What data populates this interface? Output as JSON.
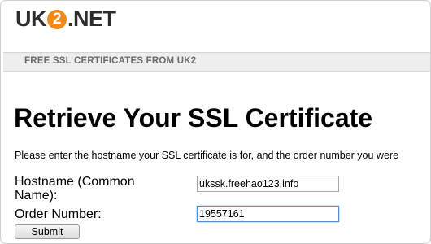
{
  "header": {
    "logo": {
      "prefix": "UK",
      "badge": "2",
      "suffix": ".NET"
    }
  },
  "banner": {
    "text": "FREE SSL CERTIFICATES FROM UK2"
  },
  "main": {
    "title": "Retrieve Your SSL Certificate",
    "instructions": "Please enter the hostname your SSL certificate is for, and the order number you were",
    "form": {
      "hostname_label": "Hostname (Common Name):",
      "hostname_value": "ukssk.freehao123.info",
      "order_label": "Order Number:",
      "order_value": "19557161",
      "submit_label": "Submit"
    }
  },
  "colors": {
    "logo_accent": "#f08a1c",
    "banner_bg": "#eeeeef",
    "banner_text": "#6b6b6b"
  }
}
